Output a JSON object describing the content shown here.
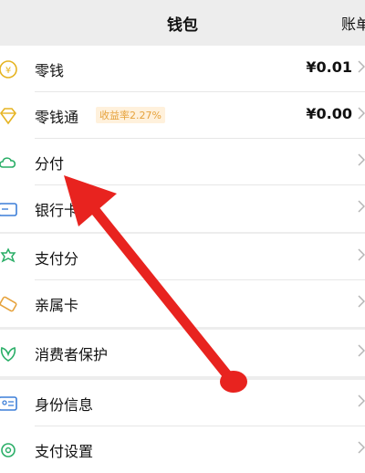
{
  "header": {
    "title": "钱包",
    "bill_link": "账单"
  },
  "groups": [
    {
      "items": [
        {
          "label": "零钱",
          "value": "¥0.01",
          "icon": "coin-icon"
        },
        {
          "label": "零钱通",
          "badge": "收益率2.27%",
          "value": "¥0.00",
          "icon": "diamond-icon"
        },
        {
          "label": "分付",
          "icon": "cloud-icon"
        },
        {
          "label": "银行卡",
          "icon": "card-icon"
        }
      ]
    },
    {
      "items": [
        {
          "label": "支付分",
          "icon": "score-icon"
        },
        {
          "label": "亲属卡",
          "icon": "family-card-icon"
        }
      ]
    },
    {
      "items": [
        {
          "label": "消费者保护",
          "icon": "shield-leaf-icon"
        }
      ]
    },
    {
      "items": [
        {
          "label": "身份信息",
          "icon": "id-card-icon"
        },
        {
          "label": "支付设置",
          "icon": "settings-icon"
        }
      ]
    }
  ],
  "colors": {
    "accent": "#e6a23c",
    "arrow": "#e8231f",
    "icon_green": "#2aae67"
  }
}
